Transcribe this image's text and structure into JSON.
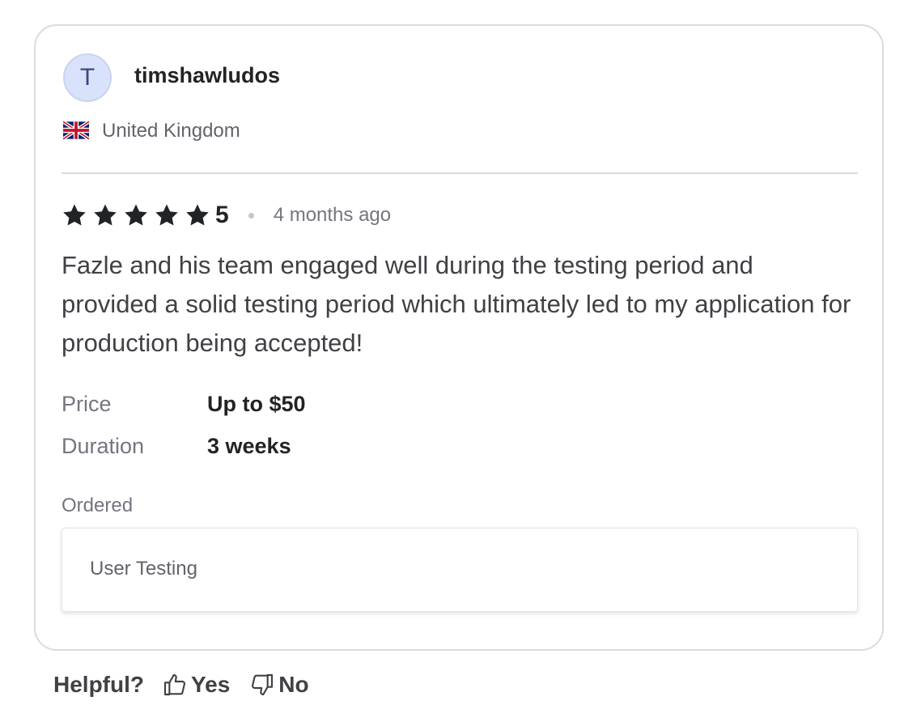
{
  "reviewer": {
    "avatar_initial": "T",
    "username": "timshawludos",
    "country": "United Kingdom",
    "flag_icon": "uk-flag-icon"
  },
  "review": {
    "stars": 5,
    "max_stars": 5,
    "rating_label": "5",
    "time_ago": "4 months ago",
    "text": "Fazle and his team engaged well during the testing period and provided a solid testing period which ultimately led to my application for production being accepted!"
  },
  "details": {
    "price_label": "Price",
    "price_value": "Up to $50",
    "duration_label": "Duration",
    "duration_value": "3 weeks"
  },
  "ordered": {
    "label": "Ordered",
    "item": "User Testing"
  },
  "helpful": {
    "question": "Helpful?",
    "yes_label": "Yes",
    "no_label": "No"
  },
  "colors": {
    "star": "#222325",
    "avatar_bg": "#d9e2fb",
    "border": "#dadbdd"
  }
}
